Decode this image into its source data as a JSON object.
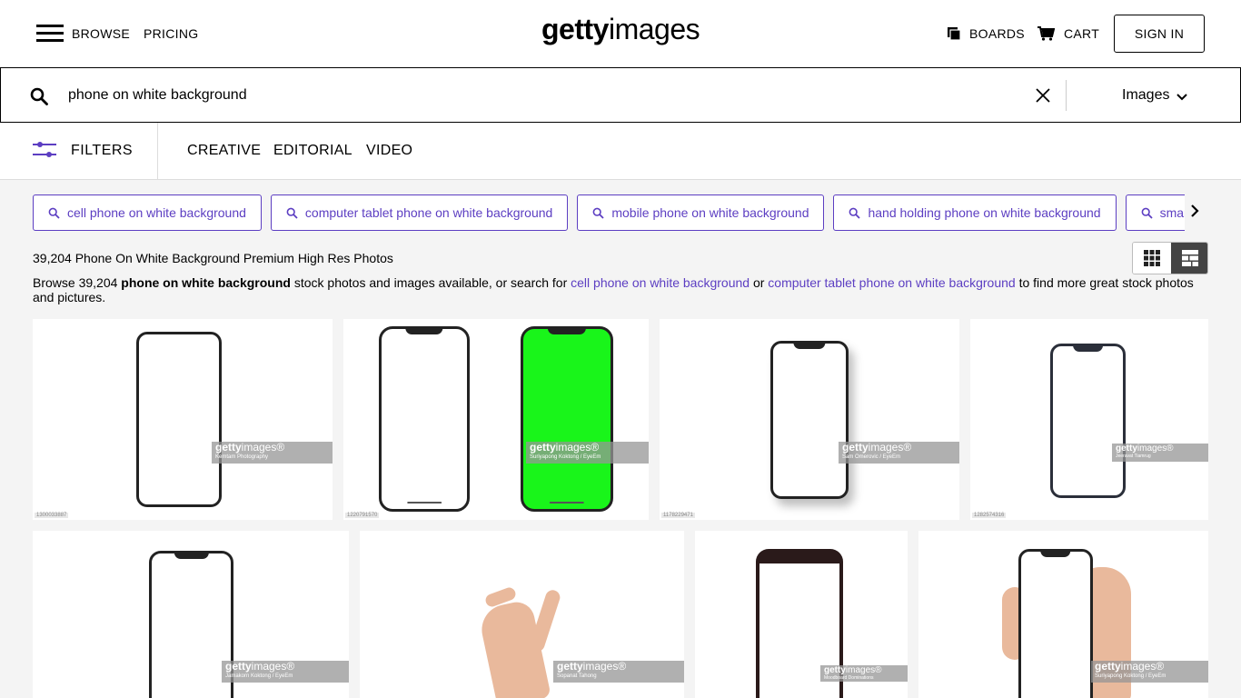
{
  "header": {
    "browse": "BROWSE",
    "pricing": "PRICING",
    "logo_bold": "getty",
    "logo_light": "images",
    "boards": "BOARDS",
    "cart": "CART",
    "sign_in": "SIGN IN"
  },
  "search": {
    "query": "phone on white background",
    "type": "Images"
  },
  "filters": {
    "label": "FILTERS",
    "tabs": [
      "CREATIVE",
      "EDITORIAL",
      "VIDEO"
    ]
  },
  "related": [
    "cell phone on white background",
    "computer tablet phone on white background",
    "mobile phone on white background",
    "hand holding phone on white background",
    "smart phone on white background"
  ],
  "results": {
    "count_title": "39,204 Phone On White Background Premium High Res Photos",
    "desc_pre": "Browse 39,204 ",
    "desc_bold": "phone on white background",
    "desc_mid": " stock photos and images available, or search for ",
    "desc_link1": "cell phone on white background",
    "desc_or": " or ",
    "desc_link2": "computer tablet phone on white background",
    "desc_post": " to find more great stock photos and pictures."
  },
  "images": [
    {
      "credit": "Kemtam Photography",
      "id": "1300033887"
    },
    {
      "credit": "Suriyapong Koktong / EyeEm",
      "id": "1220791570"
    },
    {
      "credit": "Sam Omerovic / EyeEm",
      "id": "1178229471"
    },
    {
      "credit": "Jeeravat Tiamrug",
      "id": "1282574316"
    },
    {
      "credit": "Jamakorn Koktong / EyeEm",
      "id": ""
    },
    {
      "credit": "Sopanat Tahong",
      "id": ""
    },
    {
      "credit": "Moodboard Dominations",
      "id": ""
    },
    {
      "credit": "Suriyapong Koktong / EyeEm",
      "id": ""
    }
  ],
  "watermark": {
    "bold": "getty",
    "light": "images",
    "mark": "®"
  },
  "colors": {
    "accent": "#5c3ec2",
    "green_screen": "#19f51a"
  }
}
